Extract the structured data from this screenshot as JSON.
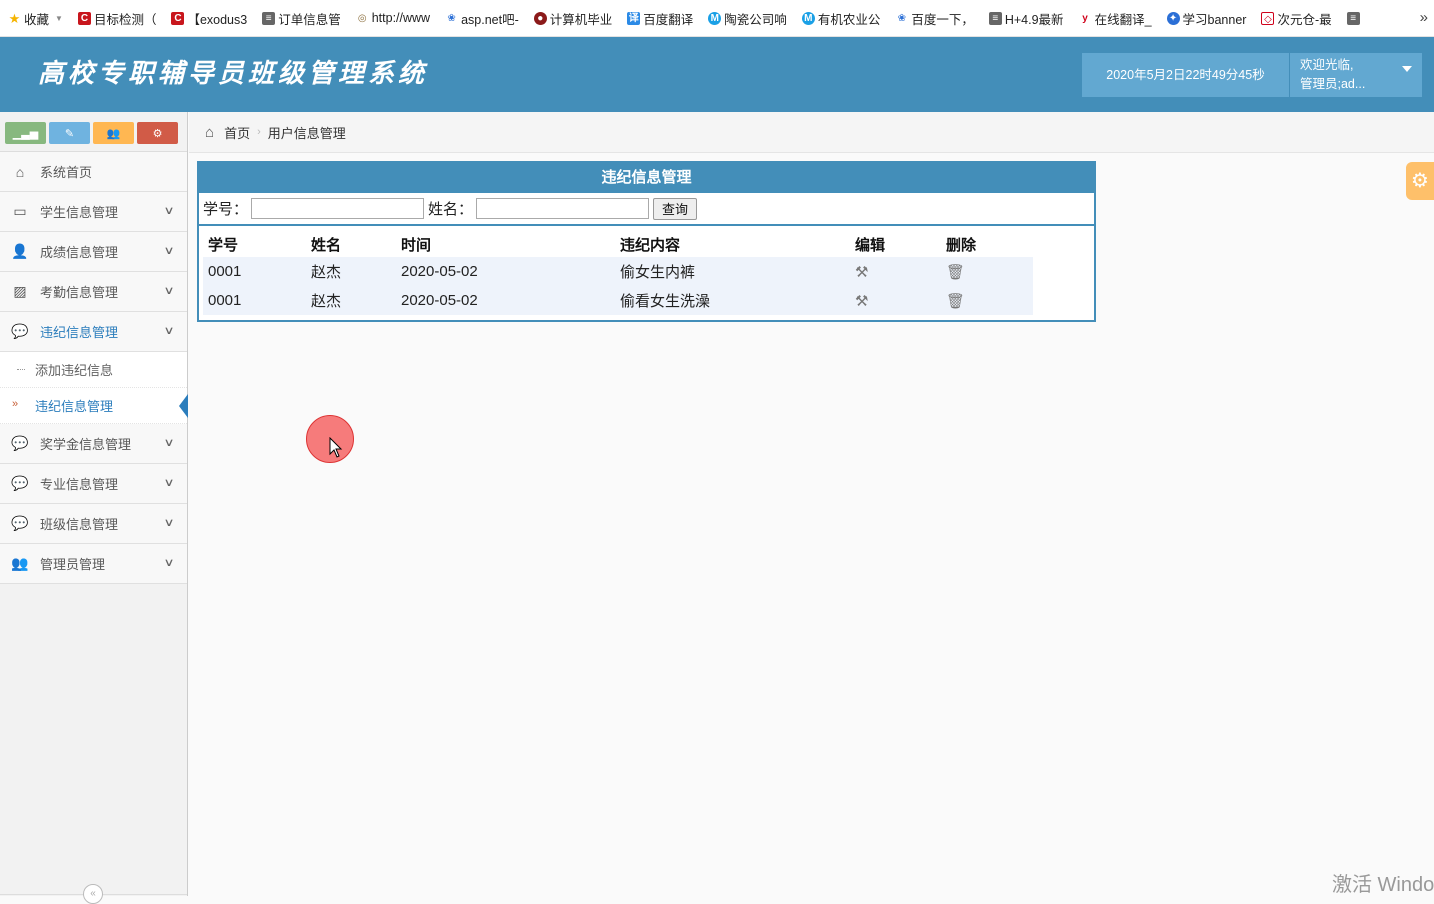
{
  "bookmarks": [
    {
      "label": "收藏",
      "icon": "star-icon",
      "color": "#f5b400"
    },
    {
      "label": "目标检测（",
      "icon": "csdn-icon",
      "color": "#c8161d"
    },
    {
      "label": "【exodus3",
      "icon": "csdn-icon",
      "color": "#c8161d"
    },
    {
      "label": "订单信息管",
      "icon": "page-icon",
      "color": "#666666"
    },
    {
      "label": "http://www",
      "icon": "globe-icon",
      "color": "#8a6d3b"
    },
    {
      "label": "asp.net吧-",
      "icon": "baidu-icon",
      "color": "#2b6fd6"
    },
    {
      "label": "计算机毕业",
      "icon": "site-icon",
      "color": "#8b1a1a"
    },
    {
      "label": "百度翻译",
      "icon": "translate-icon",
      "color": "#2b8ae6"
    },
    {
      "label": "陶瓷公司响",
      "icon": "m-icon",
      "color": "#1aa0e6"
    },
    {
      "label": "有机农业公",
      "icon": "m-icon",
      "color": "#1aa0e6"
    },
    {
      "label": "百度一下，",
      "icon": "baidu-icon",
      "color": "#2b6fd6"
    },
    {
      "label": "H+4.9最新",
      "icon": "page-icon",
      "color": "#666666"
    },
    {
      "label": "在线翻译_",
      "icon": "youdao-icon",
      "color": "#d0021b"
    },
    {
      "label": "学习banner",
      "icon": "site-icon",
      "color": "#2b6fd6"
    },
    {
      "label": "次元仓-最",
      "icon": "site-icon",
      "color": "#d0021b"
    }
  ],
  "header": {
    "title": "高校专职辅导员班级管理系统",
    "clock": "2020年5月2日22时49分45秒",
    "welcome": "欢迎光临,",
    "user": "管理员;ad..."
  },
  "shortcuts": [
    {
      "icon": "signal-icon",
      "color": "#87b87f"
    },
    {
      "icon": "pencil-icon",
      "color": "#6fb3e0"
    },
    {
      "icon": "users-icon",
      "color": "#ffb752"
    },
    {
      "icon": "cogs-icon",
      "color": "#d15b47"
    }
  ],
  "sidebar": {
    "items": [
      {
        "label": "系统首页"
      },
      {
        "label": "学生信息管理"
      },
      {
        "label": "成绩信息管理"
      },
      {
        "label": "考勤信息管理"
      },
      {
        "label": "违纪信息管理",
        "submenu": [
          "添加违纪信息",
          "违纪信息管理"
        ]
      },
      {
        "label": "奖学金信息管理"
      },
      {
        "label": "专业信息管理"
      },
      {
        "label": "班级信息管理"
      },
      {
        "label": "管理员管理"
      }
    ]
  },
  "breadcrumb": {
    "home": "首页",
    "current": "用户信息管理"
  },
  "panel": {
    "title": "违纪信息管理",
    "search": {
      "student_id_label": "学号：",
      "name_label": "姓名：",
      "button": "查询",
      "student_id_value": "",
      "name_value": ""
    },
    "columns": [
      "学号",
      "姓名",
      "时间",
      "违纪内容",
      "编辑",
      "删除"
    ],
    "rows": [
      {
        "id": "0001",
        "name": "赵杰",
        "date": "2020-05-02",
        "content": "偷女生内裤"
      },
      {
        "id": "0001",
        "name": "赵杰",
        "date": "2020-05-02",
        "content": "偷看女生洗澡"
      }
    ]
  },
  "watermark": "激活 Windo"
}
